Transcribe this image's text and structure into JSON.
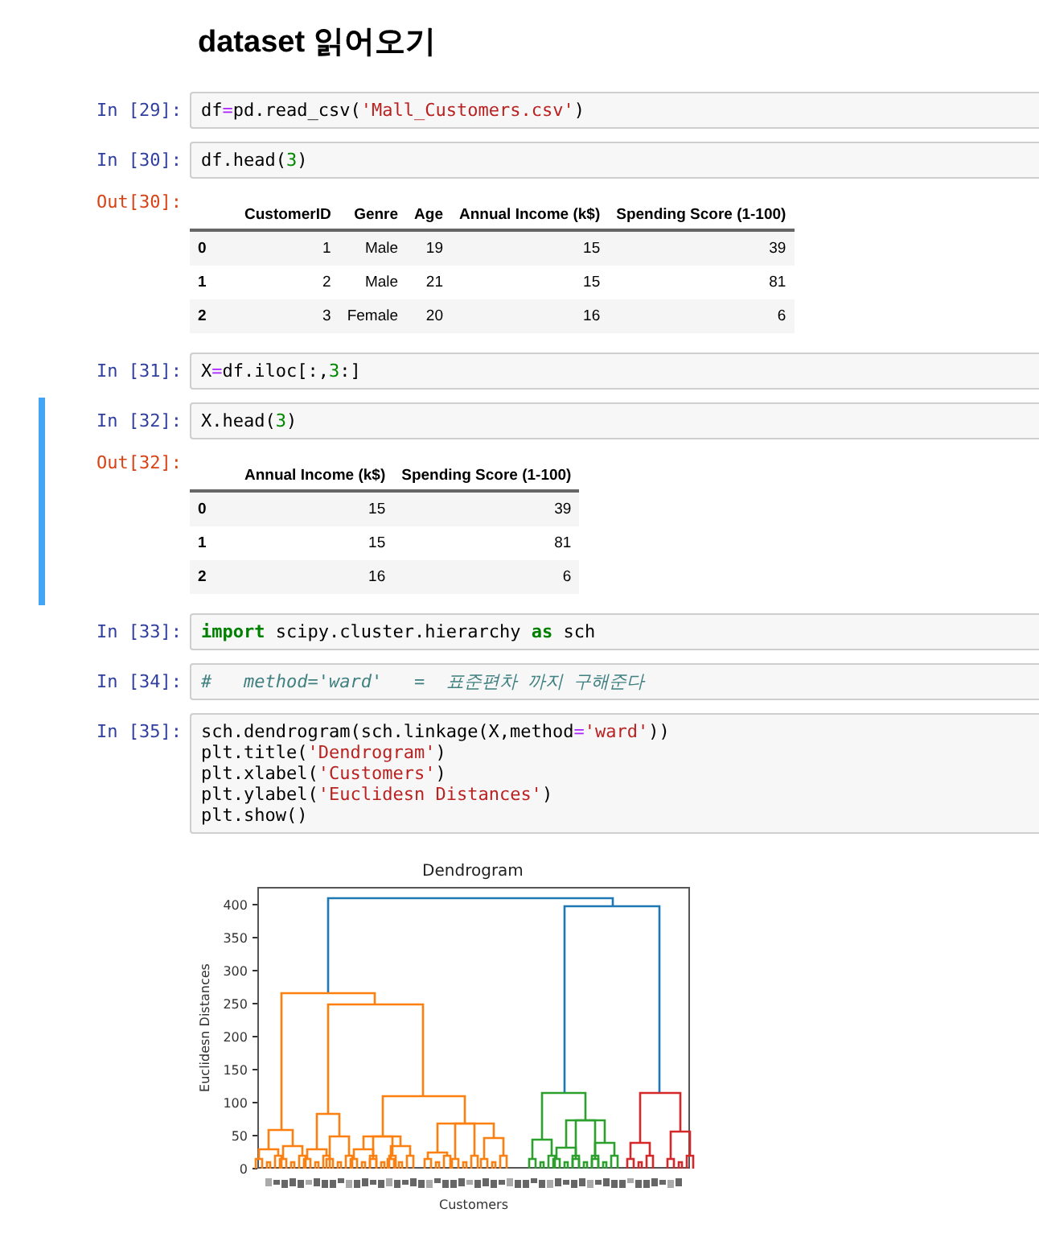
{
  "cells": [
    {
      "kind": "markdown",
      "selected": false,
      "heading": "dataset 읽어오기"
    },
    {
      "kind": "code",
      "selected": false,
      "prompt": "In [29]:",
      "lines": [
        [
          {
            "kind": "plain",
            "text": "df"
          },
          {
            "kind": "operator",
            "text": "="
          },
          {
            "kind": "plain",
            "text": "pd.read_csv("
          },
          {
            "kind": "string",
            "text": "'Mall_Customers.csv'"
          },
          {
            "kind": "plain",
            "text": ")"
          }
        ]
      ]
    },
    {
      "kind": "code",
      "selected": false,
      "prompt": "In [30]:",
      "lines": [
        [
          {
            "kind": "plain",
            "text": "df.head("
          },
          {
            "kind": "number",
            "text": "3"
          },
          {
            "kind": "plain",
            "text": ")"
          }
        ]
      ],
      "output": {
        "prompt": "Out[30]:",
        "kind": "table",
        "columns": [
          "",
          "CustomerID",
          "Genre",
          "Age",
          "Annual Income (k$)",
          "Spending Score (1-100)"
        ],
        "rows": [
          [
            "0",
            "1",
            "Male",
            "19",
            "15",
            "39"
          ],
          [
            "1",
            "2",
            "Male",
            "21",
            "15",
            "81"
          ],
          [
            "2",
            "3",
            "Female",
            "20",
            "16",
            "6"
          ]
        ]
      }
    },
    {
      "kind": "code",
      "selected": false,
      "prompt": "In [31]:",
      "lines": [
        [
          {
            "kind": "plain",
            "text": "X"
          },
          {
            "kind": "operator",
            "text": "="
          },
          {
            "kind": "plain",
            "text": "df.iloc[:,"
          },
          {
            "kind": "number",
            "text": "3"
          },
          {
            "kind": "plain",
            "text": ":]"
          }
        ]
      ]
    },
    {
      "kind": "code",
      "selected": true,
      "prompt": "In [32]:",
      "lines": [
        [
          {
            "kind": "plain",
            "text": "X.head("
          },
          {
            "kind": "number",
            "text": "3"
          },
          {
            "kind": "plain",
            "text": ")"
          }
        ]
      ],
      "output": {
        "prompt": "Out[32]:",
        "kind": "table",
        "columns": [
          "",
          "Annual Income (k$)",
          "Spending Score (1-100)"
        ],
        "rows": [
          [
            "0",
            "15",
            "39"
          ],
          [
            "1",
            "15",
            "81"
          ],
          [
            "2",
            "16",
            "6"
          ]
        ]
      }
    },
    {
      "kind": "code",
      "selected": false,
      "prompt": "In [33]:",
      "lines": [
        [
          {
            "kind": "keyword",
            "text": "import"
          },
          {
            "kind": "plain",
            "text": " scipy.cluster.hierarchy "
          },
          {
            "kind": "keyword",
            "text": "as"
          },
          {
            "kind": "plain",
            "text": " sch"
          }
        ]
      ]
    },
    {
      "kind": "code",
      "selected": false,
      "prompt": "In [34]:",
      "lines": [
        [
          {
            "kind": "comment",
            "text": "#   method='ward'   =  표준편차 까지 구해준다"
          }
        ]
      ]
    },
    {
      "kind": "code",
      "selected": false,
      "prompt": "In [35]:",
      "lines": [
        [
          {
            "kind": "plain",
            "text": "sch.dendrogram(sch.linkage(X,method"
          },
          {
            "kind": "operator",
            "text": "="
          },
          {
            "kind": "string",
            "text": "'ward'"
          },
          {
            "kind": "plain",
            "text": "))"
          }
        ],
        [
          {
            "kind": "plain",
            "text": "plt.title("
          },
          {
            "kind": "string",
            "text": "'Dendrogram'"
          },
          {
            "kind": "plain",
            "text": ")"
          }
        ],
        [
          {
            "kind": "plain",
            "text": "plt.xlabel("
          },
          {
            "kind": "string",
            "text": "'Customers'"
          },
          {
            "kind": "plain",
            "text": ")"
          }
        ],
        [
          {
            "kind": "plain",
            "text": "plt.ylabel("
          },
          {
            "kind": "string",
            "text": "'Euclidesn Distances'"
          },
          {
            "kind": "plain",
            "text": ")"
          }
        ],
        [
          {
            "kind": "plain",
            "text": "plt.show()"
          }
        ]
      ],
      "output": {
        "kind": "dendrogram",
        "title": "Dendrogram",
        "xlabel": "Customers",
        "ylabel": "Euclidesn Distances",
        "yticks": [
          "400",
          "350",
          "300",
          "250",
          "200",
          "150",
          "100",
          "50",
          "0"
        ]
      }
    }
  ]
}
